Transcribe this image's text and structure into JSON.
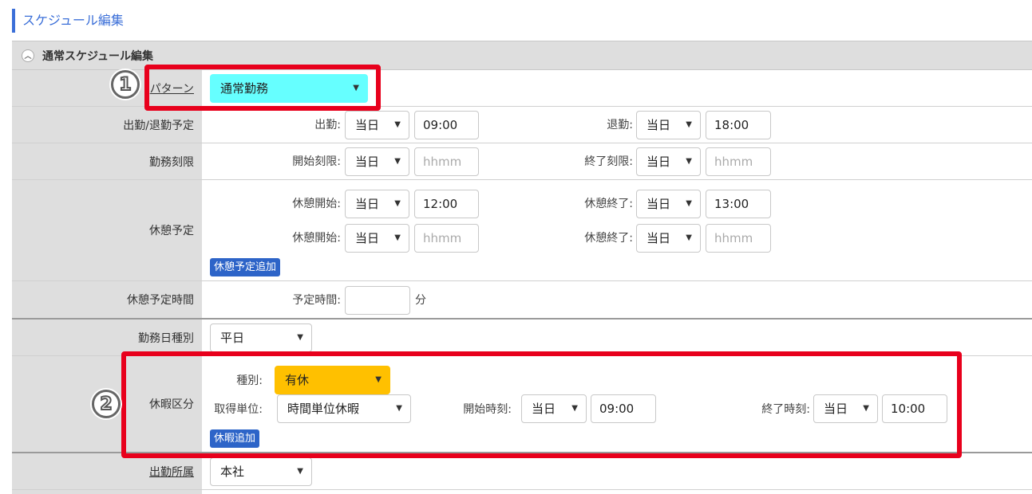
{
  "page_title": "スケジュール編集",
  "section_title": "通常スケジュール編集",
  "pattern": {
    "label": "パターン",
    "value": "通常勤務"
  },
  "attendance": {
    "label": "出勤/退勤予定",
    "start_label": "出勤:",
    "start_day": "当日",
    "start_time": "09:00",
    "end_label": "退勤:",
    "end_day": "当日",
    "end_time": "18:00"
  },
  "limit": {
    "label": "勤務刻限",
    "start_label": "開始刻限:",
    "start_day": "当日",
    "start_ph": "hhmm",
    "end_label": "終了刻限:",
    "end_day": "当日",
    "end_ph": "hhmm"
  },
  "break": {
    "label": "休憩予定",
    "start_label": "休憩開始:",
    "end_label": "休憩終了:",
    "row1": {
      "start_day": "当日",
      "start_time": "12:00",
      "end_day": "当日",
      "end_time": "13:00"
    },
    "row2": {
      "start_day": "当日",
      "start_ph": "hhmm",
      "end_day": "当日",
      "end_ph": "hhmm"
    },
    "add_button": "休憩予定追加"
  },
  "break_time": {
    "label": "休憩予定時間",
    "field_label": "予定時間:",
    "unit": "分"
  },
  "day_type": {
    "label": "勤務日種別",
    "value": "平日"
  },
  "leave": {
    "label": "休暇区分",
    "type_label": "種別:",
    "type_value": "有休",
    "unit_label": "取得単位:",
    "unit_value": "時間単位休暇",
    "start_label": "開始時刻:",
    "start_day": "当日",
    "start_time": "09:00",
    "end_label": "終了時刻:",
    "end_day": "当日",
    "end_time": "10:00",
    "add_button": "休暇追加"
  },
  "office": {
    "label": "出勤所属",
    "value": "本社"
  },
  "annotations": {
    "one": "1",
    "two": "2"
  },
  "colors": {
    "accent": "#3b6fd8",
    "pattern_bg": "#66ffff",
    "leave_bg": "#ffc000",
    "highlight": "#e8001c"
  }
}
